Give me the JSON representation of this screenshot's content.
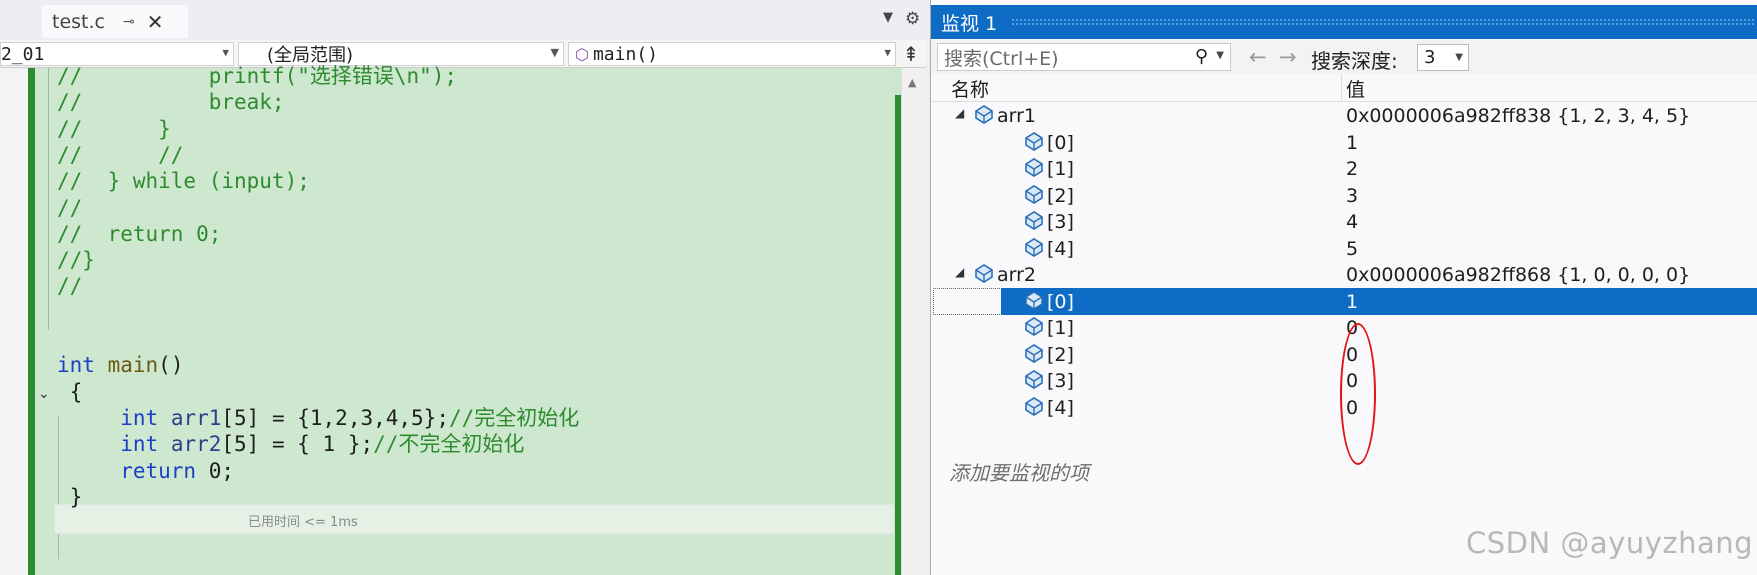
{
  "editor": {
    "tab": {
      "title": "test.c",
      "pin_glyph": "⊸",
      "close_glyph": "✕"
    },
    "nav": {
      "project": "2_01",
      "scope": "(全局范围)",
      "function": "main()",
      "split_glyph": "⇞"
    },
    "code_lines": [
      {
        "parts": [
          [
            "cm",
            "//          printf(\"选择错误\\n\");"
          ]
        ]
      },
      {
        "parts": [
          [
            "cm",
            "//          break;"
          ]
        ]
      },
      {
        "parts": [
          [
            "cm",
            "//      }"
          ]
        ]
      },
      {
        "parts": [
          [
            "cm",
            "//      //"
          ]
        ]
      },
      {
        "parts": [
          [
            "cm",
            "//  } while (input);"
          ]
        ]
      },
      {
        "parts": [
          [
            "cm",
            "//"
          ]
        ]
      },
      {
        "parts": [
          [
            "cm",
            "//  return 0;"
          ]
        ]
      },
      {
        "parts": [
          [
            "cm",
            "//}"
          ]
        ]
      },
      {
        "parts": [
          [
            "cm",
            "//"
          ]
        ]
      },
      {
        "parts": []
      },
      {
        "parts": []
      },
      {
        "parts": [
          [
            "kw",
            "int"
          ],
          [
            "",
            " "
          ],
          [
            "fn",
            "main"
          ],
          [
            "",
            "()"
          ]
        ]
      },
      {
        "parts": [
          [
            "",
            " {"
          ]
        ]
      },
      {
        "parts": [
          [
            "",
            "     "
          ],
          [
            "kw",
            "int"
          ],
          [
            "",
            " "
          ],
          [
            "var",
            "arr1"
          ],
          [
            "",
            "[5] = {1,2,3,4,5};"
          ],
          [
            "cm",
            "//完全初始化"
          ]
        ]
      },
      {
        "parts": [
          [
            "",
            "     "
          ],
          [
            "kw",
            "int"
          ],
          [
            "",
            " "
          ],
          [
            "var",
            "arr2"
          ],
          [
            "",
            "[5] = { 1 };"
          ],
          [
            "cm",
            "//不完全初始化"
          ]
        ]
      },
      {
        "parts": [
          [
            "",
            "     "
          ],
          [
            "kw",
            "return"
          ],
          [
            "",
            " 0;"
          ]
        ]
      },
      {
        "parts": [
          [
            "",
            " }"
          ]
        ]
      }
    ],
    "perf_tip": "已用时间 <= 1ms"
  },
  "watch": {
    "title": "监视 1",
    "search_placeholder": "搜索(Ctrl+E)",
    "depth_label": "搜索深度:",
    "depth_value": "3",
    "columns": {
      "name": "名称",
      "value": "值"
    },
    "rows": [
      {
        "name": "arr1",
        "value": "0x0000006a982ff838 {1, 2, 3, 4, 5}",
        "level": 0,
        "expanded": true
      },
      {
        "name": "[0]",
        "value": "1",
        "level": 1
      },
      {
        "name": "[1]",
        "value": "2",
        "level": 1
      },
      {
        "name": "[2]",
        "value": "3",
        "level": 1
      },
      {
        "name": "[3]",
        "value": "4",
        "level": 1
      },
      {
        "name": "[4]",
        "value": "5",
        "level": 1
      },
      {
        "name": "arr2",
        "value": "0x0000006a982ff868 {1, 0, 0, 0, 0}",
        "level": 0,
        "expanded": true
      },
      {
        "name": "[0]",
        "value": "1",
        "level": 1,
        "selected": true
      },
      {
        "name": "[1]",
        "value": "0",
        "level": 1
      },
      {
        "name": "[2]",
        "value": "0",
        "level": 1
      },
      {
        "name": "[3]",
        "value": "0",
        "level": 1
      },
      {
        "name": "[4]",
        "value": "0",
        "level": 1
      }
    ],
    "add_item": "添加要监视的项"
  },
  "watermark": "CSDN @ayuyzhang",
  "colors": {
    "accent": "#0e6cc4",
    "editor_bg": "#cde8cf",
    "change_bar": "#2e8b33",
    "annotation": "#e01515"
  }
}
